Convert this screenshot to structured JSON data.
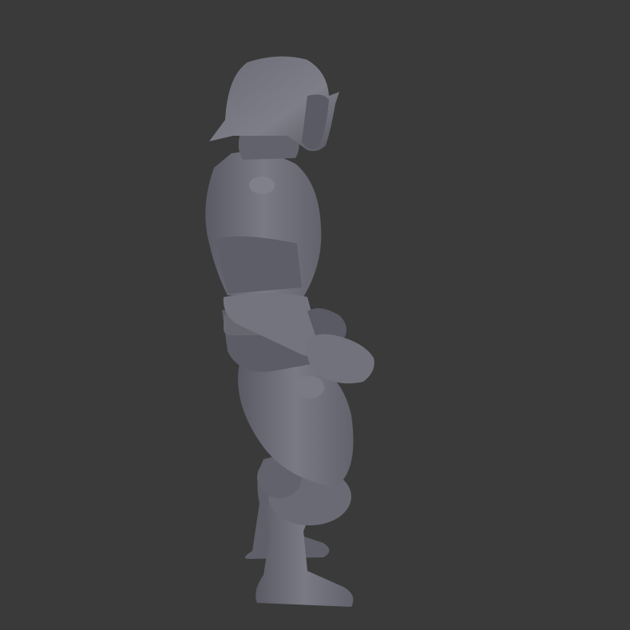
{
  "scene": {
    "background_color": "#3a3a3a",
    "model_color": "#6e6e78",
    "model_shadow_color": "#4f4f58",
    "model_highlight_color": "#8a8a94",
    "subject": "action-figure-side-view"
  }
}
